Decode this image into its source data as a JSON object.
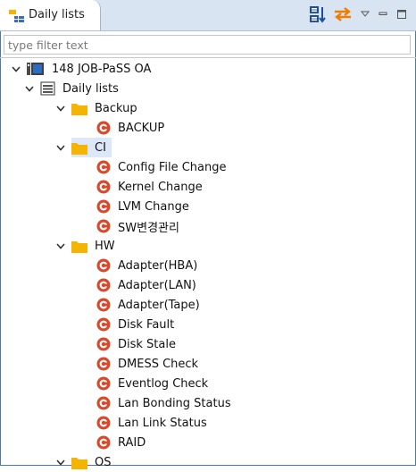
{
  "view": {
    "tab_title": "Daily lists"
  },
  "filter": {
    "placeholder": "type filter text"
  },
  "tree": {
    "root_label": "148 JOB-PaSS OA",
    "list_label": "Daily lists",
    "groups": [
      {
        "label": "Backup",
        "items": [
          "BACKUP"
        ]
      },
      {
        "label": "CI",
        "items": [
          "Config File Change",
          "Kernel Change",
          "LVM Change",
          "SW변경관리"
        ]
      },
      {
        "label": "HW",
        "items": [
          "Adapter(HBA)",
          "Adapter(LAN)",
          "Adapter(Tape)",
          "Disk Fault",
          "Disk Stale",
          "DMESS Check",
          "Eventlog Check",
          "Lan Bonding Status",
          "Lan Link Status",
          "RAID"
        ]
      },
      {
        "label": "OS",
        "items": []
      }
    ]
  },
  "colors": {
    "folder": "#f4b400",
    "check_icon": "#d9482b",
    "accent_blue": "#2f5fa8"
  }
}
